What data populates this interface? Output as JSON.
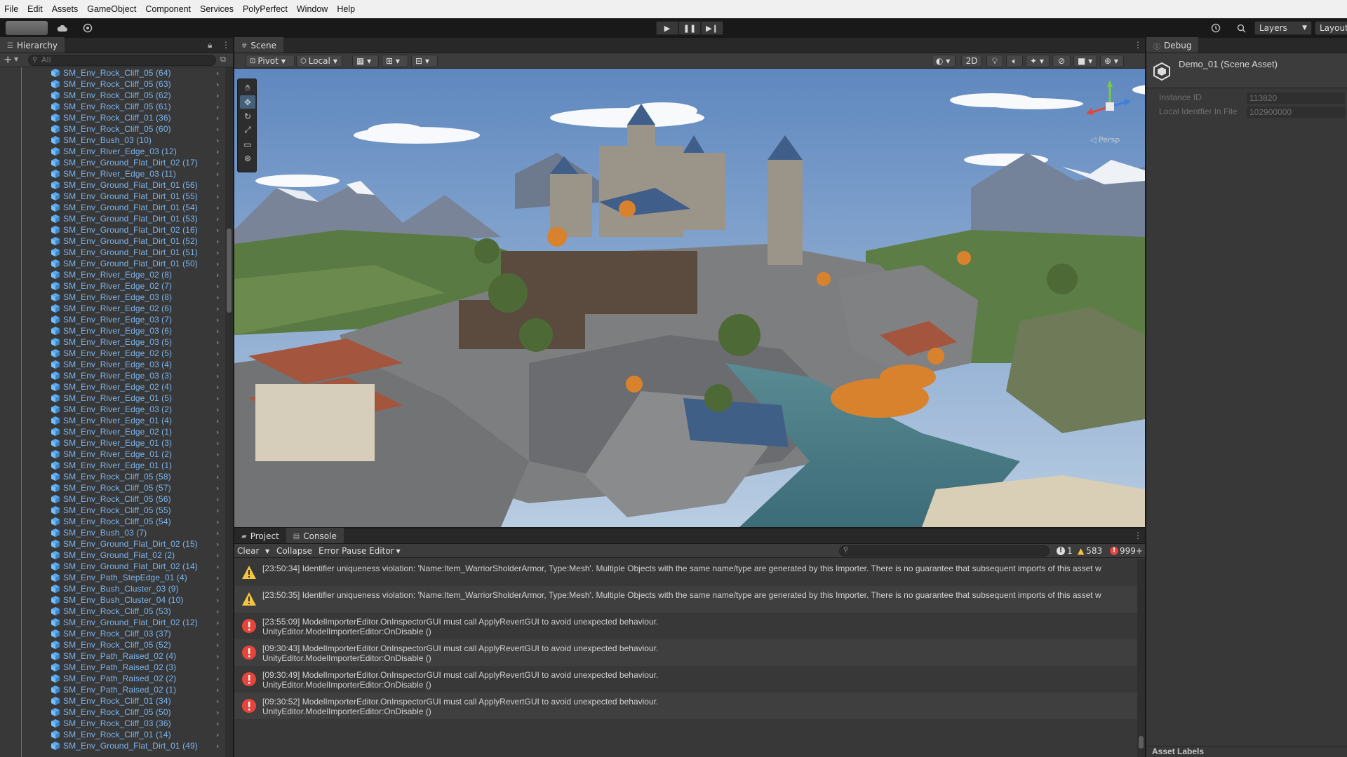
{
  "menubar": {
    "items": [
      "File",
      "Edit",
      "Assets",
      "GameObject",
      "Component",
      "Services",
      "PolyPerfect",
      "Window",
      "Help"
    ]
  },
  "toolbar": {
    "layers_label": "Layers",
    "layout_label": "Layout",
    "play_icon": "play-icon",
    "pause_icon": "pause-icon",
    "step_icon": "step-icon"
  },
  "hierarchy": {
    "tab_label": "Hierarchy",
    "search_placeholder": "All",
    "items": [
      "SM_Env_Rock_Cliff_05 (64)",
      "SM_Env_Rock_Cliff_05 (63)",
      "SM_Env_Rock_Cliff_05 (62)",
      "SM_Env_Rock_Cliff_05 (61)",
      "SM_Env_Rock_Cliff_01 (36)",
      "SM_Env_Rock_Cliff_05 (60)",
      "SM_Env_Bush_03 (10)",
      "SM_Env_River_Edge_03 (12)",
      "SM_Env_Ground_Flat_Dirt_02 (17)",
      "SM_Env_River_Edge_03 (11)",
      "SM_Env_Ground_Flat_Dirt_01 (56)",
      "SM_Env_Ground_Flat_Dirt_01 (55)",
      "SM_Env_Ground_Flat_Dirt_01 (54)",
      "SM_Env_Ground_Flat_Dirt_01 (53)",
      "SM_Env_Ground_Flat_Dirt_02 (16)",
      "SM_Env_Ground_Flat_Dirt_01 (52)",
      "SM_Env_Ground_Flat_Dirt_01 (51)",
      "SM_Env_Ground_Flat_Dirt_01 (50)",
      "SM_Env_River_Edge_02 (8)",
      "SM_Env_River_Edge_02 (7)",
      "SM_Env_River_Edge_03 (8)",
      "SM_Env_River_Edge_02 (6)",
      "SM_Env_River_Edge_03 (7)",
      "SM_Env_River_Edge_03 (6)",
      "SM_Env_River_Edge_03 (5)",
      "SM_Env_River_Edge_02 (5)",
      "SM_Env_River_Edge_03 (4)",
      "SM_Env_River_Edge_03 (3)",
      "SM_Env_River_Edge_02 (4)",
      "SM_Env_River_Edge_01 (5)",
      "SM_Env_River_Edge_03 (2)",
      "SM_Env_River_Edge_01 (4)",
      "SM_Env_River_Edge_02 (1)",
      "SM_Env_River_Edge_01 (3)",
      "SM_Env_River_Edge_01 (2)",
      "SM_Env_River_Edge_01 (1)",
      "SM_Env_Rock_Cliff_05 (58)",
      "SM_Env_Rock_Cliff_05 (57)",
      "SM_Env_Rock_Cliff_05 (56)",
      "SM_Env_Rock_Cliff_05 (55)",
      "SM_Env_Rock_Cliff_05 (54)",
      "SM_Env_Bush_03 (7)",
      "SM_Env_Ground_Flat_Dirt_02 (15)",
      "SM_Env_Ground_Flat_02 (2)",
      "SM_Env_Ground_Flat_Dirt_02 (14)",
      "SM_Env_Path_StepEdge_01 (4)",
      "SM_Env_Bush_Cluster_03 (9)",
      "SM_Env_Bush_Cluster_04 (10)",
      "SM_Env_Rock_Cliff_05 (53)",
      "SM_Env_Ground_Flat_Dirt_02 (12)",
      "SM_Env_Rock_Cliff_03 (37)",
      "SM_Env_Rock_Cliff_05 (52)",
      "SM_Env_Path_Raised_02 (4)",
      "SM_Env_Path_Raised_02 (3)",
      "SM_Env_Path_Raised_02 (2)",
      "SM_Env_Path_Raised_02 (1)",
      "SM_Env_Rock_Cliff_01 (34)",
      "SM_Env_Rock_Cliff_05 (50)",
      "SM_Env_Rock_Cliff_03 (36)",
      "SM_Env_Rock_Cliff_01 (14)",
      "SM_Env_Ground_Flat_Dirt_01 (49)"
    ]
  },
  "scene": {
    "tab_label": "Scene",
    "pivot_label": "Pivot",
    "local_label": "Local",
    "mode_2d_label": "2D",
    "persp_label": "Persp"
  },
  "console": {
    "project_tab": "Project",
    "console_tab": "Console",
    "clear_label": "Clear",
    "collapse_label": "Collapse",
    "error_pause_label": "Error Pause",
    "editor_label": "Editor",
    "log_count": "1",
    "warn_count": "583",
    "error_count": "999+",
    "entries": [
      {
        "type": "warning",
        "line1": "[23:50:34] Identifier uniqueness violation: 'Name:Item_WarriorSholderArmor, Type:Mesh'. Multiple Objects with the same name/type are generated by this Importer. There is no guarantee that subsequent imports of this asset w",
        "line2": ""
      },
      {
        "type": "warning",
        "line1": "[23:50:35] Identifier uniqueness violation: 'Name:Item_WarriorSholderArmor, Type:Mesh'. Multiple Objects with the same name/type are generated by this Importer. There is no guarantee that subsequent imports of this asset w",
        "line2": ""
      },
      {
        "type": "error",
        "line1": "[23:55:09] ModelImporterEditor.OnInspectorGUI must call ApplyRevertGUI to avoid unexpected behaviour.",
        "line2": "UnityEditor.ModelImporterEditor:OnDisable ()"
      },
      {
        "type": "error",
        "line1": "[09:30:43] ModelImporterEditor.OnInspectorGUI must call ApplyRevertGUI to avoid unexpected behaviour.",
        "line2": "UnityEditor.ModelImporterEditor:OnDisable ()"
      },
      {
        "type": "error",
        "line1": "[09:30:49] ModelImporterEditor.OnInspectorGUI must call ApplyRevertGUI to avoid unexpected behaviour.",
        "line2": "UnityEditor.ModelImporterEditor:OnDisable ()"
      },
      {
        "type": "error",
        "line1": "[09:30:52] ModelImporterEditor.OnInspectorGUI must call ApplyRevertGUI to avoid unexpected behaviour.",
        "line2": "UnityEditor.ModelImporterEditor:OnDisable ()"
      }
    ]
  },
  "inspector": {
    "tab_label": "Debug",
    "asset_title": "Demo_01 (Scene Asset)",
    "instance_id_label": "Instance ID",
    "instance_id_value": "113820",
    "local_id_label": "Local Identfier In File",
    "local_id_value": "102900000",
    "asset_labels": "Asset Labels"
  },
  "colors": {
    "accent": "#3a78c8",
    "hierarchy_text": "#7bb4ee",
    "warning": "#f4c542",
    "error": "#e5453b"
  }
}
